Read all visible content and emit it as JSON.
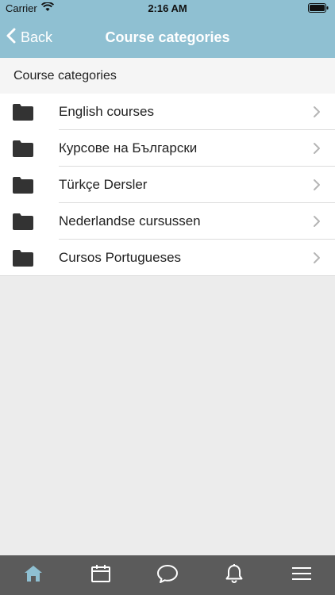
{
  "status": {
    "carrier": "Carrier",
    "time": "2:16 AM"
  },
  "nav": {
    "back_label": "Back",
    "title": "Course categories"
  },
  "section": {
    "header": "Course categories"
  },
  "categories": [
    {
      "label": "English courses"
    },
    {
      "label": "Курсове на Български"
    },
    {
      "label": "Türkçe Dersler"
    },
    {
      "label": "Nederlandse cursussen"
    },
    {
      "label": "Cursos Portugueses"
    }
  ],
  "tabbar": {
    "items": [
      {
        "icon": "home-icon",
        "active": true
      },
      {
        "icon": "calendar-icon",
        "active": false
      },
      {
        "icon": "chat-icon",
        "active": false
      },
      {
        "icon": "bell-icon",
        "active": false
      },
      {
        "icon": "menu-icon",
        "active": false
      }
    ]
  },
  "colors": {
    "header_bg": "#8fc0d2",
    "tabbar_bg": "#5b5b5b",
    "tab_active": "#8fc0d2"
  }
}
